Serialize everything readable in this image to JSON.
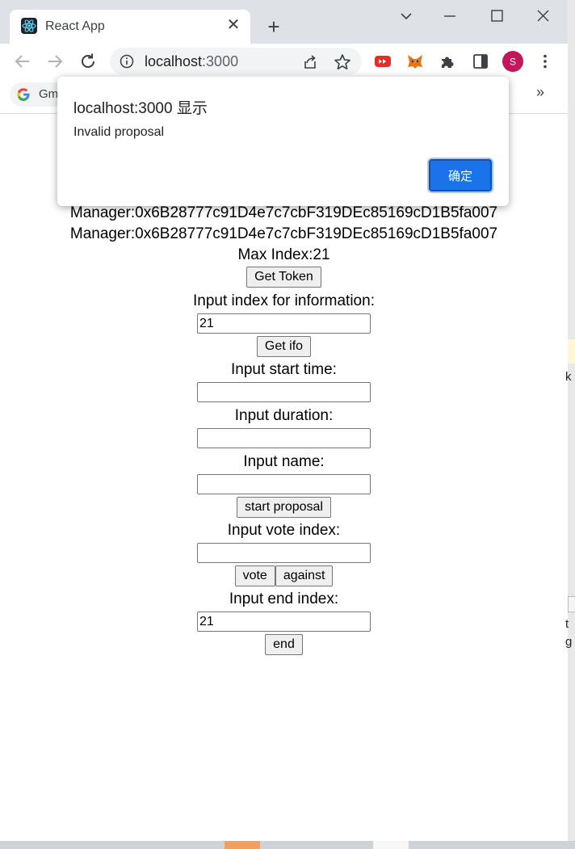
{
  "browser": {
    "tab_title": "React App",
    "tab_close": "✕",
    "new_tab": "+",
    "address_host": "localhost",
    "address_port": ":3000",
    "bookmark_label": "Gm",
    "bookmarks_more": "»",
    "profile_initial": "S",
    "colors": {
      "tabstrip": "#dee1e6",
      "profile": "#c2185b",
      "dialog_button": "#1a73e8"
    }
  },
  "dialog": {
    "title": "localhost:3000 显示",
    "message": "Invalid proposal",
    "ok_label": "确定"
  },
  "page": {
    "manager_line_1": "Manager:0x6B28777c91D4e7c7cbF319DEc85169cD1B5fa007",
    "manager_line_2": "Manager:0x6B28777c91D4e7c7cbF319DEc85169cD1B5fa007",
    "max_index": "Max Index:21",
    "get_token_label": "Get Token",
    "info_prompt": "Input index for information:",
    "info_index_value": "21",
    "get_info_label": "Get ifo",
    "start_time_prompt": "Input start time:",
    "start_time_value": "",
    "duration_prompt": "Input duration:",
    "duration_value": "",
    "name_prompt": "Input name:",
    "name_value": "",
    "start_proposal_label": "start proposal",
    "vote_prompt": "Input vote index:",
    "vote_value": "",
    "vote_label": "vote",
    "against_label": "against",
    "end_prompt": "Input end index:",
    "end_index_value": "21",
    "end_label": "end"
  },
  "desktop": {
    "frag_1": "k",
    "frag_2": "t",
    "frag_3": "g"
  }
}
